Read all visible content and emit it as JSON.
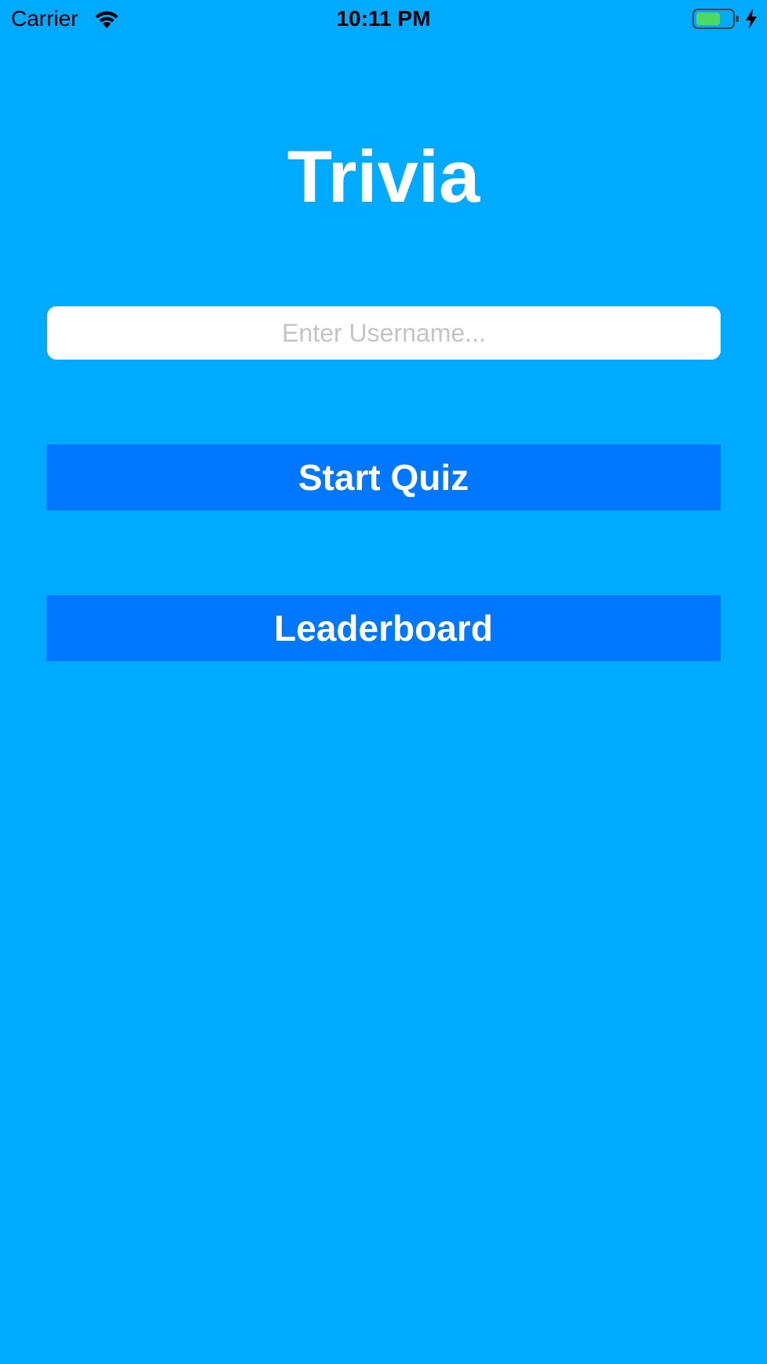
{
  "status_bar": {
    "carrier": "Carrier",
    "time": "10:11 PM",
    "battery_color": "#4cd964",
    "icons": [
      "wifi-icon",
      "battery-icon",
      "charging-bolt-icon"
    ]
  },
  "main": {
    "title": "Trivia",
    "username_placeholder": "Enter Username...",
    "username_value": "",
    "start_quiz_label": "Start Quiz",
    "leaderboard_label": "Leaderboard"
  },
  "colors": {
    "background": "#00aaff",
    "button": "#0077ff",
    "text": "#ffffff"
  }
}
